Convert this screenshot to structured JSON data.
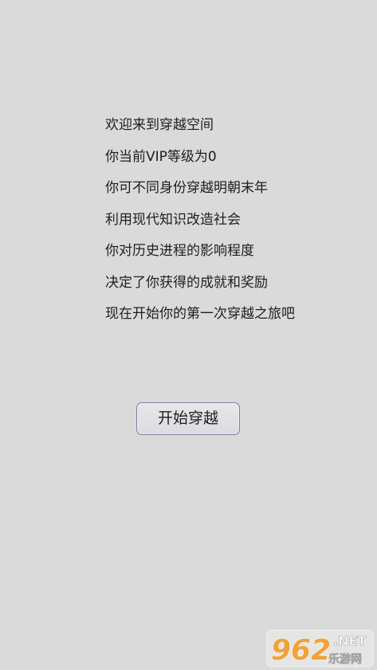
{
  "intro": {
    "lines": [
      "欢迎来到穿越空间",
      "你当前VIP等级为0",
      "你可不同身份穿越明朝末年",
      "利用现代知识改造社会",
      "你对历史进程的影响程度",
      "决定了你获得的成就和奖励",
      "现在开始你的第一次穿越之旅吧"
    ]
  },
  "start_button": {
    "label": "开始穿越"
  },
  "watermark": {
    "number": "962",
    "suffix": ".NET",
    "site_name": "乐游网"
  },
  "colors": {
    "background": "#dadada",
    "text": "#1e1e1e",
    "button_border": "#7b7ba8",
    "watermark_orange": "#f39a1e"
  }
}
